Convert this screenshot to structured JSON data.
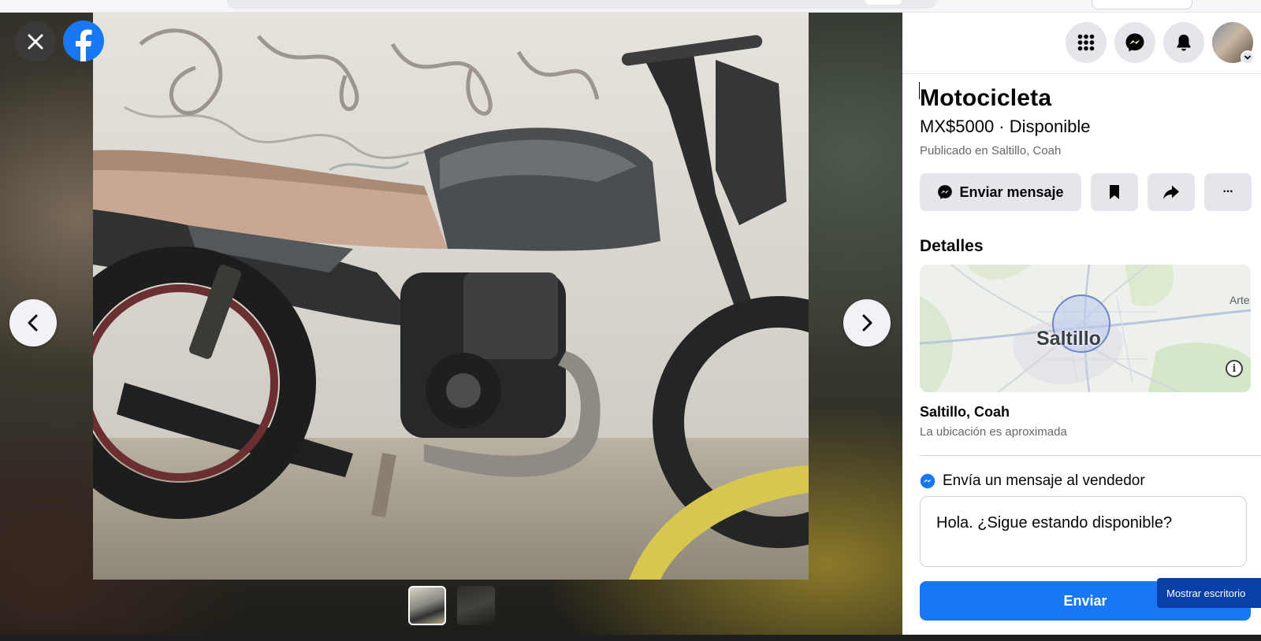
{
  "listing": {
    "title": "Motocicleta",
    "price_status": "MX$5000 · Disponible",
    "published": "Publicado en Saltillo, Coah"
  },
  "actions": {
    "send_message_label": "Enviar mensaje",
    "save_icon": "bookmark-icon",
    "share_icon": "share-icon",
    "more_label": "···"
  },
  "details": {
    "heading": "Detalles",
    "map_city_label": "Saltillo",
    "map_partial_label": "Arte",
    "map_info_glyph": "i",
    "city": "Saltillo, Coah",
    "approx": "La ubicación es aproximada"
  },
  "seller_message": {
    "heading": "Envía un mensaje al vendedor",
    "text": "Hola. ¿Sigue estando disponible?",
    "send_label": "Enviar"
  },
  "tooltip": "Mostrar escritorio",
  "header_icons": [
    "menu-grid-icon",
    "messenger-icon",
    "bell-icon",
    "avatar"
  ],
  "colors": {
    "brand": "#1877f2",
    "button_gray": "#e4e6eb",
    "secondary_text": "#65676b",
    "tooltip_bg": "#0a3fa8"
  },
  "viewer": {
    "thumbnails": 2,
    "selected_thumbnail": 1
  }
}
